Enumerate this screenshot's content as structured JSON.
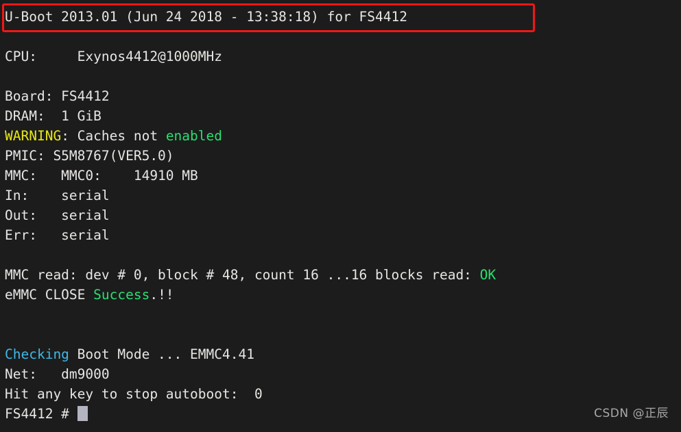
{
  "terminal": {
    "background_color": "#1c1c1c",
    "default_text_color": "#e8e6e3",
    "colors": {
      "white": "#e8e6e3",
      "yellow": "#e8e818",
      "green": "#28e070",
      "cyan": "#3fb8e8",
      "highlight_red": "#f41616",
      "cursor": "#b4b4c0"
    },
    "lines": [
      {
        "id": "line-banner",
        "segments": [
          {
            "text": "U-Boot 2013.01 (Jun 24 2018 - 13:38:18) for FS4412",
            "color": "white"
          }
        ]
      },
      {
        "id": "line-blank-1",
        "segments": [
          {
            "text": "",
            "color": "white"
          }
        ]
      },
      {
        "id": "line-cpu",
        "segments": [
          {
            "text": "CPU:     Exynos4412@1000MHz",
            "color": "white"
          }
        ]
      },
      {
        "id": "line-blank-2",
        "segments": [
          {
            "text": "",
            "color": "white"
          }
        ]
      },
      {
        "id": "line-board",
        "segments": [
          {
            "text": "Board: FS4412",
            "color": "white"
          }
        ]
      },
      {
        "id": "line-dram",
        "segments": [
          {
            "text": "DRAM:  1 GiB",
            "color": "white"
          }
        ]
      },
      {
        "id": "line-warning",
        "segments": [
          {
            "text": "WARNING",
            "color": "yellow"
          },
          {
            "text": ": Caches not ",
            "color": "white"
          },
          {
            "text": "enabled",
            "color": "green"
          }
        ]
      },
      {
        "id": "line-pmic",
        "segments": [
          {
            "text": "PMIC: S5M8767(VER5.0)",
            "color": "white"
          }
        ]
      },
      {
        "id": "line-mmc",
        "segments": [
          {
            "text": "MMC:   MMC0:    14910 MB",
            "color": "white"
          }
        ]
      },
      {
        "id": "line-in",
        "segments": [
          {
            "text": "In:    serial",
            "color": "white"
          }
        ]
      },
      {
        "id": "line-out",
        "segments": [
          {
            "text": "Out:   serial",
            "color": "white"
          }
        ]
      },
      {
        "id": "line-err",
        "segments": [
          {
            "text": "Err:   serial",
            "color": "white"
          }
        ]
      },
      {
        "id": "line-blank-3",
        "segments": [
          {
            "text": "",
            "color": "white"
          }
        ]
      },
      {
        "id": "line-mmc-read",
        "segments": [
          {
            "text": "MMC read: dev # 0, block # 48, count 16 ...16 blocks read: ",
            "color": "white"
          },
          {
            "text": "OK",
            "color": "green"
          }
        ]
      },
      {
        "id": "line-emmc-close",
        "segments": [
          {
            "text": "eMMC CLOSE ",
            "color": "white"
          },
          {
            "text": "Success",
            "color": "green"
          },
          {
            "text": ".!!",
            "color": "white"
          }
        ]
      },
      {
        "id": "line-blank-4",
        "segments": [
          {
            "text": "",
            "color": "white"
          }
        ]
      },
      {
        "id": "line-blank-5",
        "segments": [
          {
            "text": "",
            "color": "white"
          }
        ]
      },
      {
        "id": "line-checking",
        "segments": [
          {
            "text": "Checking",
            "color": "cyan"
          },
          {
            "text": " Boot Mode ... EMMC4.41",
            "color": "white"
          }
        ]
      },
      {
        "id": "line-net",
        "segments": [
          {
            "text": "Net:   dm9000",
            "color": "white"
          }
        ]
      },
      {
        "id": "line-autoboot",
        "segments": [
          {
            "text": "Hit any key to stop autoboot:  0",
            "color": "white"
          }
        ]
      },
      {
        "id": "line-prompt",
        "segments": [
          {
            "text": "FS4412 # ",
            "color": "white"
          }
        ],
        "cursor": true
      }
    ]
  },
  "highlight": {
    "label": "u-boot-version-banner-highlight",
    "color": "#f41616"
  },
  "watermark": {
    "text": "CSDN @正辰"
  }
}
